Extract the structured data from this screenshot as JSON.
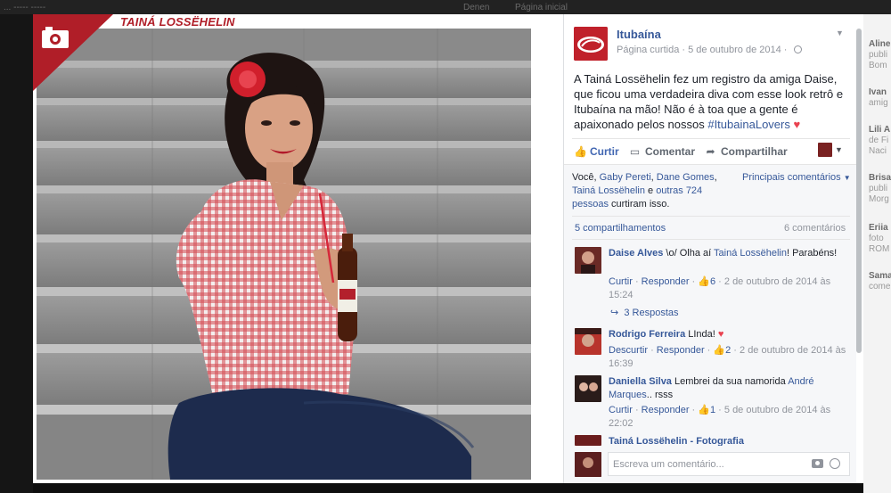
{
  "background": {
    "top_bar": [
      "... ----- -----",
      "Denen",
      "Página inicial"
    ],
    "right_ticker": [
      {
        "name": "Aline",
        "lines": [
          "publi",
          "Bom"
        ]
      },
      {
        "name": "Ivan",
        "lines": [
          "amig"
        ]
      },
      {
        "name": "Lili A",
        "lines": [
          "de Fi",
          "Naci"
        ]
      },
      {
        "name": "Brisa",
        "lines": [
          "publi",
          "Morg"
        ]
      },
      {
        "name": "Eriia",
        "lines": [
          "foto",
          "ROM"
        ]
      },
      {
        "name": "Sama",
        "lines": [
          "come"
        ]
      }
    ]
  },
  "photo": {
    "watermark": "TAINÁ LOSSËHELIN"
  },
  "post": {
    "page_name": "Itubaína",
    "page_status": "Página curtida",
    "date": "5 de outubro de 2014",
    "text_before_tag": "A Tainá Lossëhelin fez um registro da amiga Daise, que ficou uma verdadeira diva com esse look retrô e Itubaína na mão! Não é à toa que a gente é apaixonado pelos nossos ",
    "hashtag": "#ItubainaLovers",
    "actions": {
      "like": "Curtir",
      "comment": "Comentar",
      "share": "Compartilhar"
    }
  },
  "feedback": {
    "likes": {
      "prefix": "Você, ",
      "friends": [
        "Gaby Pereti",
        "Dane Gomes",
        "Tainá Lossëhelin"
      ],
      "others": "outras 724 pessoas",
      "suffix": " curtiram isso."
    },
    "sort_label": "Principais comentários",
    "shares": "5 compartilhamentos",
    "comments_total": "6 comentários"
  },
  "comments": [
    {
      "author": "Daise Alves",
      "text_before": "\\o/ Olha aí ",
      "mention": "Tainá Lossëhelin",
      "text_after": "! Parabéns!",
      "like_label": "Curtir",
      "reply_label": "Responder",
      "likes": "6",
      "date": "2 de outubro de 2014 às 15:24",
      "replies": "3 Respostas"
    },
    {
      "author": "Rodrigo Ferreira",
      "text": "LInda!",
      "like_label": "Descurtir",
      "reply_label": "Responder",
      "likes": "2",
      "date": "2 de outubro de 2014 às 16:39"
    },
    {
      "author": "Daniella Silva",
      "text_before": "Lembrei da sua namorida ",
      "mention": "André Marques",
      "text_after": ".. rsss",
      "like_label": "Curtir",
      "reply_label": "Responder",
      "likes": "1",
      "date": "5 de outubro de 2014 às 22:02"
    },
    {
      "author": "Tainá Lossëhelin - Fotografia"
    }
  ],
  "composer": {
    "placeholder": "Escreva um comentário..."
  },
  "colors": {
    "brand_red": "#c0212b",
    "link_blue": "#365899",
    "heart": "#e9414f"
  },
  "icons": [
    "like-thumb-icon",
    "comment-bubble-icon",
    "share-arrow-icon",
    "globe-icon",
    "chevron-down-icon",
    "camera-icon",
    "emoji-icon",
    "reply-arrow-icon",
    "heart-icon"
  ]
}
